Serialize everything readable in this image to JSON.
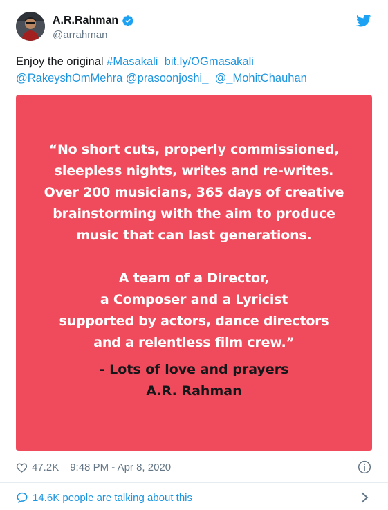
{
  "author": {
    "name": "A.R.Rahman",
    "handle": "@arrahman"
  },
  "text": {
    "prefix": "Enjoy the original ",
    "hashtag": "#Masakali",
    "url": "bit.ly/OGmasakali",
    "mention1": "@RakeyshOmMehra",
    "mention2": "@prasoonjoshi_",
    "mention3": "@_MohitChauhan"
  },
  "image": {
    "background_color": "#ef4b5c",
    "quote_lines": [
      "“No short cuts, properly commissioned,",
      "sleepless nights, writes and re-writes.",
      "Over 200 musicians, 365 days of creative",
      "brainstorming with the aim to produce",
      "music that can last generations."
    ],
    "quote_lines_2": [
      "A team of a Director,",
      "a Composer and a Lyricist",
      "supported by actors, dance directors",
      "and a relentless film crew.”"
    ],
    "signature_lines": [
      "- Lots of love and prayers",
      "A.R. Rahman"
    ]
  },
  "footer": {
    "likes": "47.2K",
    "timestamp": "9:48 PM - Apr 8, 2020",
    "conversation": "14.6K people are talking about this"
  },
  "colors": {
    "accent": "#1b95e0",
    "muted": "#657786"
  },
  "icons": [
    "avatar",
    "verified-badge-icon",
    "twitter-bird-icon",
    "heart-icon",
    "info-icon",
    "comment-bubble-icon",
    "chevron-right-icon"
  ]
}
